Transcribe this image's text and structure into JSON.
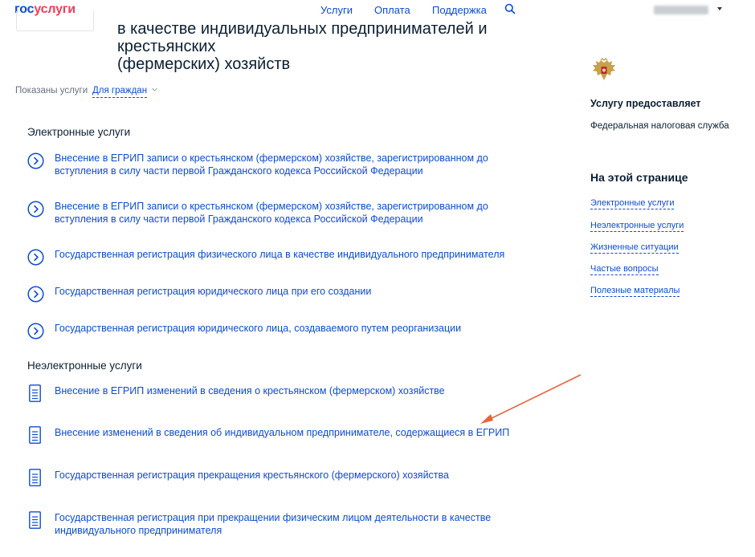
{
  "header": {
    "logo_part1": "гос",
    "logo_part2": "услуги",
    "nav": {
      "services": "Услуги",
      "payment": "Оплата",
      "support": "Поддержка"
    }
  },
  "title": {
    "line1": "в качестве индивидуальных предпринимателей и крестьянских",
    "line2": "(фермерских) хозяйств"
  },
  "filter": {
    "label": "Показаны услуги",
    "value": "Для граждан"
  },
  "electronic": {
    "heading": "Электронные услуги",
    "items": [
      {
        "line1": "Внесение в ЕГРИП записи о крестьянском (фермерском) хозяйстве, зарегистрированном до",
        "line2": "вступления в силу части первой Гражданского кодекса Российской Федерации"
      },
      {
        "line1": "Внесение в ЕГРИП записи о крестьянском (фермерском) хозяйстве, зарегистрированном до",
        "line2": "вступления в силу части первой Гражданского кодекса Российской Федерации"
      },
      {
        "line1": "Государственная регистрация физического лица в качестве индивидуального предпринимателя",
        "line2": ""
      },
      {
        "line1": "Государственная регистрация юридического лица при его создании",
        "line2": ""
      },
      {
        "line1": "Государственная регистрация юридического лица, создаваемого путем реорганизации",
        "line2": ""
      }
    ]
  },
  "non_electronic": {
    "heading": "Неэлектронные услуги",
    "items": [
      {
        "line1": "Внесение в ЕГРИП изменений в сведения о крестьянском (фермерском) хозяйстве",
        "line2": ""
      },
      {
        "line1": "Внесение изменений в сведения об индивидуальном предпринимателе, содержащиеся в ЕГРИП",
        "line2": ""
      },
      {
        "line1": "Государственная регистрация прекращения крестьянского (фермерского) хозяйства",
        "line2": ""
      },
      {
        "line1": "Государственная регистрация при прекращении физическим лицом деятельности в качестве",
        "line2": "индивидуального предпринимателя"
      }
    ]
  },
  "sidebar": {
    "provider_heading": "Услугу предоставляет",
    "provider": "Федеральная налоговая служба",
    "on_page_heading": "На этой странице",
    "links": [
      "Электронные услуги",
      "Неэлектронные услуги",
      "Жизненные ситуации",
      "Частые вопросы",
      "Полезные материалы"
    ]
  },
  "colors": {
    "link": "#0d4cd3",
    "brand_red": "#ee3f58",
    "annotation_arrow": "#e8643c"
  }
}
